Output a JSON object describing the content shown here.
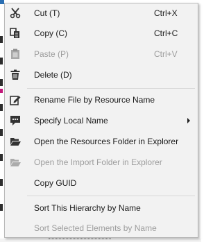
{
  "menu": {
    "items": [
      {
        "label": "Cut (T)",
        "shortcut": "Ctrl+X",
        "icon": "scissors-icon",
        "enabled": true
      },
      {
        "label": "Copy (C)",
        "shortcut": "Ctrl+C",
        "icon": "copy-icon",
        "enabled": true
      },
      {
        "label": "Paste (P)",
        "shortcut": "Ctrl+V",
        "icon": "clipboard-icon",
        "enabled": false
      },
      {
        "label": "Delete (D)",
        "shortcut": "",
        "icon": "trash-icon",
        "enabled": true
      },
      {
        "label": "Rename File by Resource Name",
        "shortcut": "",
        "icon": "rename-icon",
        "enabled": true
      },
      {
        "label": "Specify Local Name",
        "shortcut": "",
        "icon": "comment-icon",
        "enabled": true,
        "submenu": true
      },
      {
        "label": "Open the Resources Folder in Explorer",
        "shortcut": "",
        "icon": "folder-open-icon",
        "enabled": true
      },
      {
        "label": "Open the Import Folder in Explorer",
        "shortcut": "",
        "icon": "folder-open-icon",
        "enabled": false
      },
      {
        "label": "Copy GUID",
        "shortcut": "",
        "icon": "",
        "enabled": true
      },
      {
        "label": "Sort This Hierarchy by Name",
        "shortcut": "",
        "icon": "",
        "enabled": true
      },
      {
        "label": "Sort Selected Elements by Name",
        "shortcut": "",
        "icon": "",
        "enabled": false
      }
    ]
  },
  "colors": {
    "menu_bg": "#f2f2f2",
    "icon_color": "#333333",
    "disabled_text": "#9d9d9d",
    "separator": "#d7d7d7"
  }
}
